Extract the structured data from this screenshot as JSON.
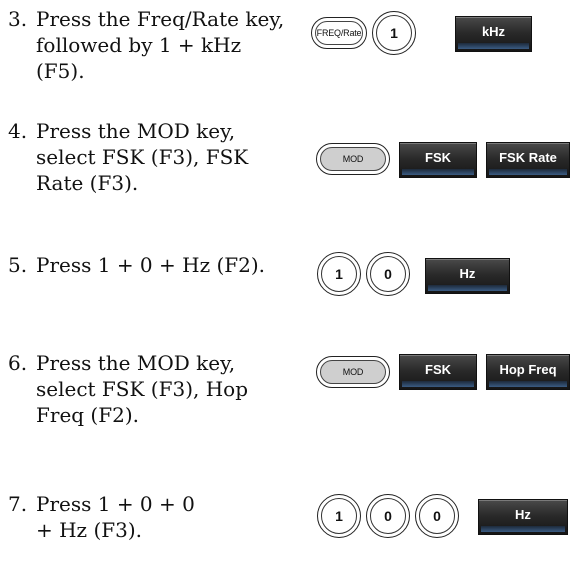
{
  "steps": [
    {
      "number": "3.",
      "text": "Press the Freq/Rate key, followed by 1 + kHz (F5).",
      "keys": {
        "freq_rate": "FREQ/Rate",
        "digit_1": "1",
        "khz": "kHz"
      }
    },
    {
      "number": "4.",
      "text": "Press the MOD key, select FSK (F3), FSK Rate (F3).",
      "keys": {
        "mod": "MOD",
        "fsk": "FSK",
        "fsk_rate": "FSK Rate"
      }
    },
    {
      "number": "5.",
      "text": "Press 1 + 0 + Hz (F2).",
      "keys": {
        "digit_1": "1",
        "digit_0": "0",
        "hz": "Hz"
      }
    },
    {
      "number": "6.",
      "text": "Press the MOD key, select FSK (F3), Hop Freq (F2).",
      "keys": {
        "mod": "MOD",
        "fsk": "FSK",
        "hop_freq": "Hop Freq"
      }
    },
    {
      "number": "7.",
      "text": "Press 1 + 0 + 0 + Hz (F3).",
      "keys": {
        "digit_1": "1",
        "digit_0a": "0",
        "digit_0b": "0",
        "hz": "Hz"
      }
    }
  ]
}
